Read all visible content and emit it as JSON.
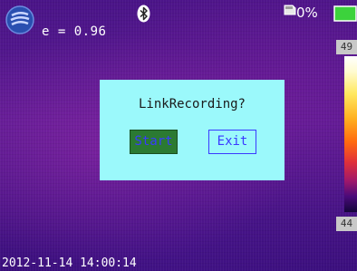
{
  "status_bar": {
    "emissivity": "e = 0.96",
    "card_value": "0%",
    "menu_icon": "menu-logo-icon",
    "bluetooth_icon": "bluetooth-icon",
    "card_icon": "sd-card-icon",
    "battery_icon": "battery-icon"
  },
  "temperature_scale": {
    "max": "49",
    "min": "44"
  },
  "dialog": {
    "title": "LinkRecording?",
    "start_label": "Start",
    "exit_label": "Exit"
  },
  "timestamp": "2012-11-14 14:00:14",
  "colors": {
    "dialog_background": "#9bf9fb",
    "start_button": "#2b7a32",
    "button_text": "#3a3aff",
    "battery": "#3cd23c"
  }
}
